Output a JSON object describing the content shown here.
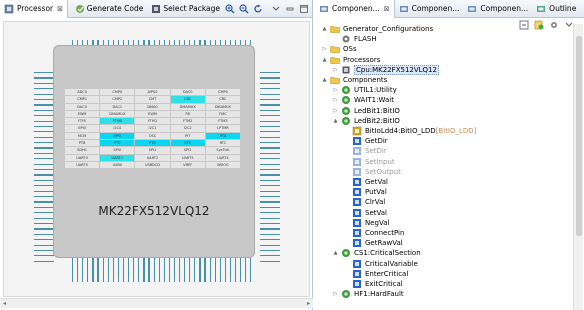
{
  "left_panel": {
    "tab_title": "Processor",
    "close_symbol": "⊠",
    "toolbar": {
      "generate_code": "Generate Code",
      "select_package": "Select Package"
    },
    "chip": {
      "name": "MK22FX512VLQ12",
      "grid_rows": [
        [
          {
            "t": "ADC0",
            "c": ""
          },
          {
            "t": "CMP0",
            "c": ""
          },
          {
            "t": "AIPS0",
            "c": ""
          },
          {
            "t": "DAC0",
            "c": ""
          },
          {
            "t": "CMP0",
            "c": ""
          }
        ],
        [
          {
            "t": "CMP1",
            "c": ""
          },
          {
            "t": "CMP2",
            "c": ""
          },
          {
            "t": "CMT",
            "c": ""
          },
          {
            "t": "CRC",
            "c": "cy"
          },
          {
            "t": "CRC",
            "c": ""
          }
        ],
        [
          {
            "t": "DAC0",
            "c": ""
          },
          {
            "t": "DAC1",
            "c": ""
          },
          {
            "t": "DMA0",
            "c": ""
          },
          {
            "t": "DMAMUX",
            "c": ""
          },
          {
            "t": "DMAMUX",
            "c": ""
          }
        ],
        [
          {
            "t": "EWM",
            "c": ""
          },
          {
            "t": "DMAMUX",
            "c": ""
          },
          {
            "t": "EWM",
            "c": ""
          },
          {
            "t": "FB",
            "c": ""
          },
          {
            "t": "FMC",
            "c": ""
          }
        ],
        [
          {
            "t": "FTFE",
            "c": ""
          },
          {
            "t": "FTM0",
            "c": "cy"
          },
          {
            "t": "FTM1",
            "c": ""
          },
          {
            "t": "FTM2",
            "c": ""
          },
          {
            "t": "FTM3",
            "c": ""
          }
        ],
        [
          {
            "t": "GPIO",
            "c": ""
          },
          {
            "t": "I2C0",
            "c": ""
          },
          {
            "t": "I2C1",
            "c": ""
          },
          {
            "t": "I2C2",
            "c": ""
          },
          {
            "t": "LPTMR",
            "c": ""
          }
        ],
        [
          {
            "t": "MCM",
            "c": ""
          },
          {
            "t": "MPU",
            "c": "bl"
          },
          {
            "t": "OSC",
            "c": ""
          },
          {
            "t": "PIT",
            "c": ""
          },
          {
            "t": "PTA",
            "c": "bl"
          }
        ],
        [
          {
            "t": "PTB",
            "c": ""
          },
          {
            "t": "PTC",
            "c": "bl"
          },
          {
            "t": "PTD",
            "c": "bl"
          },
          {
            "t": "PTE",
            "c": "bl"
          },
          {
            "t": "RTC",
            "c": ""
          }
        ],
        [
          {
            "t": "SDHC",
            "c": ""
          },
          {
            "t": "SPI0",
            "c": ""
          },
          {
            "t": "SPI1",
            "c": ""
          },
          {
            "t": "SPI2",
            "c": ""
          },
          {
            "t": "SysTick",
            "c": ""
          }
        ],
        [
          {
            "t": "UART0",
            "c": ""
          },
          {
            "t": "UART1",
            "c": "cy"
          },
          {
            "t": "UART2",
            "c": ""
          },
          {
            "t": "UART3",
            "c": ""
          },
          {
            "t": "UART4",
            "c": ""
          }
        ],
        [
          {
            "t": "UART5",
            "c": ""
          },
          {
            "t": "USB0",
            "c": ""
          },
          {
            "t": "USBDCD",
            "c": ""
          },
          {
            "t": "VREF",
            "c": ""
          },
          {
            "t": "WDOG",
            "c": ""
          }
        ]
      ]
    }
  },
  "right_panel": {
    "tabs": [
      {
        "label": "Componen...",
        "active": true
      },
      {
        "label": "Componen...",
        "active": false
      },
      {
        "label": "Componen...",
        "active": false
      },
      {
        "label": "Outline",
        "active": false
      }
    ],
    "tree": [
      {
        "label": "Generator_Configurations",
        "depth": 0,
        "toggle": "▲",
        "icon": "folder"
      },
      {
        "label": "FLASH",
        "depth": 1,
        "toggle": "",
        "icon": "gear"
      },
      {
        "label": "OSs",
        "depth": 0,
        "toggle": "▷",
        "icon": "folder"
      },
      {
        "label": "Processors",
        "depth": 0,
        "toggle": "▲",
        "icon": "folder"
      },
      {
        "label": "Cpu:MK22FX512VLQ12",
        "depth": 1,
        "toggle": "▷",
        "icon": "cpu",
        "selected": true
      },
      {
        "label": "Components",
        "depth": 0,
        "toggle": "▲",
        "icon": "folder"
      },
      {
        "label": "UTIL1:Utility",
        "depth": 1,
        "toggle": "▷",
        "icon": "comp"
      },
      {
        "label": "WAIT1:Wait",
        "depth": 1,
        "toggle": "▷",
        "icon": "comp"
      },
      {
        "label": "LedBit1:BitIO",
        "depth": 1,
        "toggle": "▷",
        "icon": "comp"
      },
      {
        "label": "LedBit2:BitIO",
        "depth": 1,
        "toggle": "▲",
        "icon": "comp"
      },
      {
        "label": "BitIoLdd4:BitIO_LDD",
        "extra": "[BitIO_LDD]",
        "depth": 2,
        "toggle": "",
        "icon": "ldd"
      },
      {
        "label": "GetDir",
        "depth": 2,
        "toggle": "",
        "icon": "method"
      },
      {
        "label": "SetDir",
        "depth": 2,
        "toggle": "",
        "icon": "method-dis",
        "disabled": true
      },
      {
        "label": "SetInput",
        "depth": 2,
        "toggle": "",
        "icon": "method-dis",
        "disabled": true
      },
      {
        "label": "SetOutput",
        "depth": 2,
        "toggle": "",
        "icon": "method-dis",
        "disabled": true
      },
      {
        "label": "GetVal",
        "depth": 2,
        "toggle": "",
        "icon": "method"
      },
      {
        "label": "PutVal",
        "depth": 2,
        "toggle": "",
        "icon": "method"
      },
      {
        "label": "ClrVal",
        "depth": 2,
        "toggle": "",
        "icon": "method"
      },
      {
        "label": "SetVal",
        "depth": 2,
        "toggle": "",
        "icon": "method"
      },
      {
        "label": "NegVal",
        "depth": 2,
        "toggle": "",
        "icon": "method"
      },
      {
        "label": "ConnectPin",
        "depth": 2,
        "toggle": "",
        "icon": "method"
      },
      {
        "label": "GetRawVal",
        "depth": 2,
        "toggle": "",
        "icon": "method"
      },
      {
        "label": "CS1:CriticalSection",
        "depth": 1,
        "toggle": "▲",
        "icon": "comp"
      },
      {
        "label": "CriticalVariable",
        "depth": 2,
        "toggle": "",
        "icon": "method"
      },
      {
        "label": "EnterCritical",
        "depth": 2,
        "toggle": "",
        "icon": "method"
      },
      {
        "label": "ExitCritical",
        "depth": 2,
        "toggle": "",
        "icon": "method"
      },
      {
        "label": "HF1:HardFault",
        "depth": 1,
        "toggle": "▷",
        "icon": "comp"
      }
    ]
  }
}
